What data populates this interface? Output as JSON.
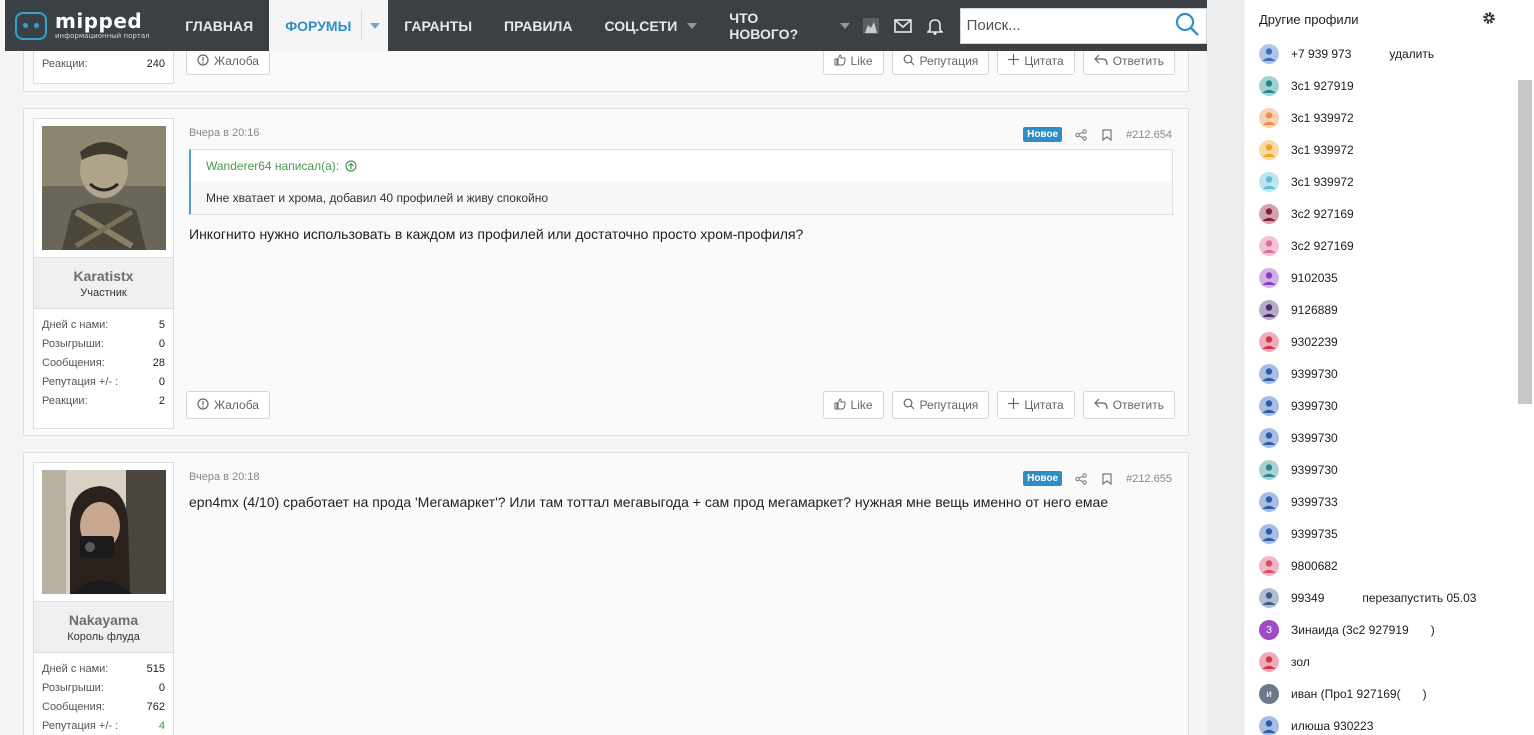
{
  "brand": {
    "name": "mipped",
    "tagline": "информационный портал"
  },
  "nav": {
    "items": [
      {
        "label": "ГЛАВНАЯ"
      },
      {
        "label": "ФОРУМЫ"
      },
      {
        "label": "ГАРАНТЫ"
      },
      {
        "label": "ПРАВИЛА"
      },
      {
        "label": "СОЦ.СЕТИ"
      },
      {
        "label": "ЧТО НОВОГО?"
      }
    ],
    "search_placeholder": "Поиск..."
  },
  "prev_post": {
    "stat_label": "Реакции:",
    "stat_value": "240"
  },
  "action_labels": {
    "report": "Жалоба",
    "like": "Like",
    "reputation": "Репутация",
    "quote": "Цитата",
    "reply": "Ответить"
  },
  "new_badge": "Новое",
  "posts": [
    {
      "author": "Karatistx",
      "role": "Участник",
      "time": "Вчера в 20:16",
      "number": "#212.654",
      "quote_author": "Wanderer64 написал(а):",
      "quote_text": "Мне хватает и хрома, добавил 40 профилей и живу спокойно",
      "text": "Инкогнито нужно использовать в каждом из профилей или достаточно просто хром-профиля?",
      "stats": [
        {
          "label": "Дней с нами:",
          "value": "5"
        },
        {
          "label": "Розыгрыши:",
          "value": "0"
        },
        {
          "label": "Сообщения:",
          "value": "28"
        },
        {
          "label": "Репутация +/- :",
          "value": "0"
        },
        {
          "label": "Реакции:",
          "value": "2"
        }
      ]
    },
    {
      "author": "Nakayama",
      "role": "Король флуда",
      "time": "Вчера в 20:18",
      "number": "#212.655",
      "text": "epn4mx (4/10) сработает на прода 'Мегамаркет'? Или там тоттал мегавыгода + сам прод мегамаркет? нужная мне вещь именно от него емае",
      "stats": [
        {
          "label": "Дней с нами:",
          "value": "515"
        },
        {
          "label": "Розыгрыши:",
          "value": "0"
        },
        {
          "label": "Сообщения:",
          "value": "762"
        },
        {
          "label": "Репутация +/- :",
          "value": "4"
        }
      ]
    }
  ],
  "sidebar": {
    "title": "Другие профили",
    "profiles": [
      {
        "name": "+7 939 973",
        "note": "удалить",
        "color": "#3a6fc4"
      },
      {
        "name": "3с1 927919",
        "color": "#1f8a8a"
      },
      {
        "name": "3с1 939972",
        "color": "#f28a4a"
      },
      {
        "name": "3с1 939972",
        "color": "#f5a020"
      },
      {
        "name": "3с1 939972",
        "color": "#5bbfd6"
      },
      {
        "name": "3с2 927169",
        "color": "#8a1c3a"
      },
      {
        "name": "3с2 927169",
        "color": "#e06a9a"
      },
      {
        "name": "9102035",
        "color": "#8a3ac4"
      },
      {
        "name": "9126889",
        "color": "#4a2a6a"
      },
      {
        "name": "9302239",
        "color": "#d63050"
      },
      {
        "name": "9399730",
        "color": "#2a5ab4"
      },
      {
        "name": "9399730",
        "color": "#2a5ab4"
      },
      {
        "name": "9399730",
        "color": "#2a5ab4"
      },
      {
        "name": "9399730",
        "color": "#2a8a8a"
      },
      {
        "name": "9399733",
        "color": "#2a5ab4"
      },
      {
        "name": "9399735",
        "color": "#2a5ab4"
      },
      {
        "name": "9800682",
        "color": "#e04a6a"
      },
      {
        "name": "99349",
        "note": "перезапустить 05.03",
        "color": "#3a5a8a"
      },
      {
        "name": "Зинаида (3с2 927919",
        "suffix": ")",
        "color": "#a04ac4",
        "letter": "З"
      },
      {
        "name": "зол",
        "color": "#d6304a"
      },
      {
        "name": "иван (Про1 927169(",
        "suffix": ")",
        "color": "#6a7a8a",
        "letter": "и"
      },
      {
        "name": "илюша 930223",
        "color": "#2a5ab4"
      }
    ]
  }
}
